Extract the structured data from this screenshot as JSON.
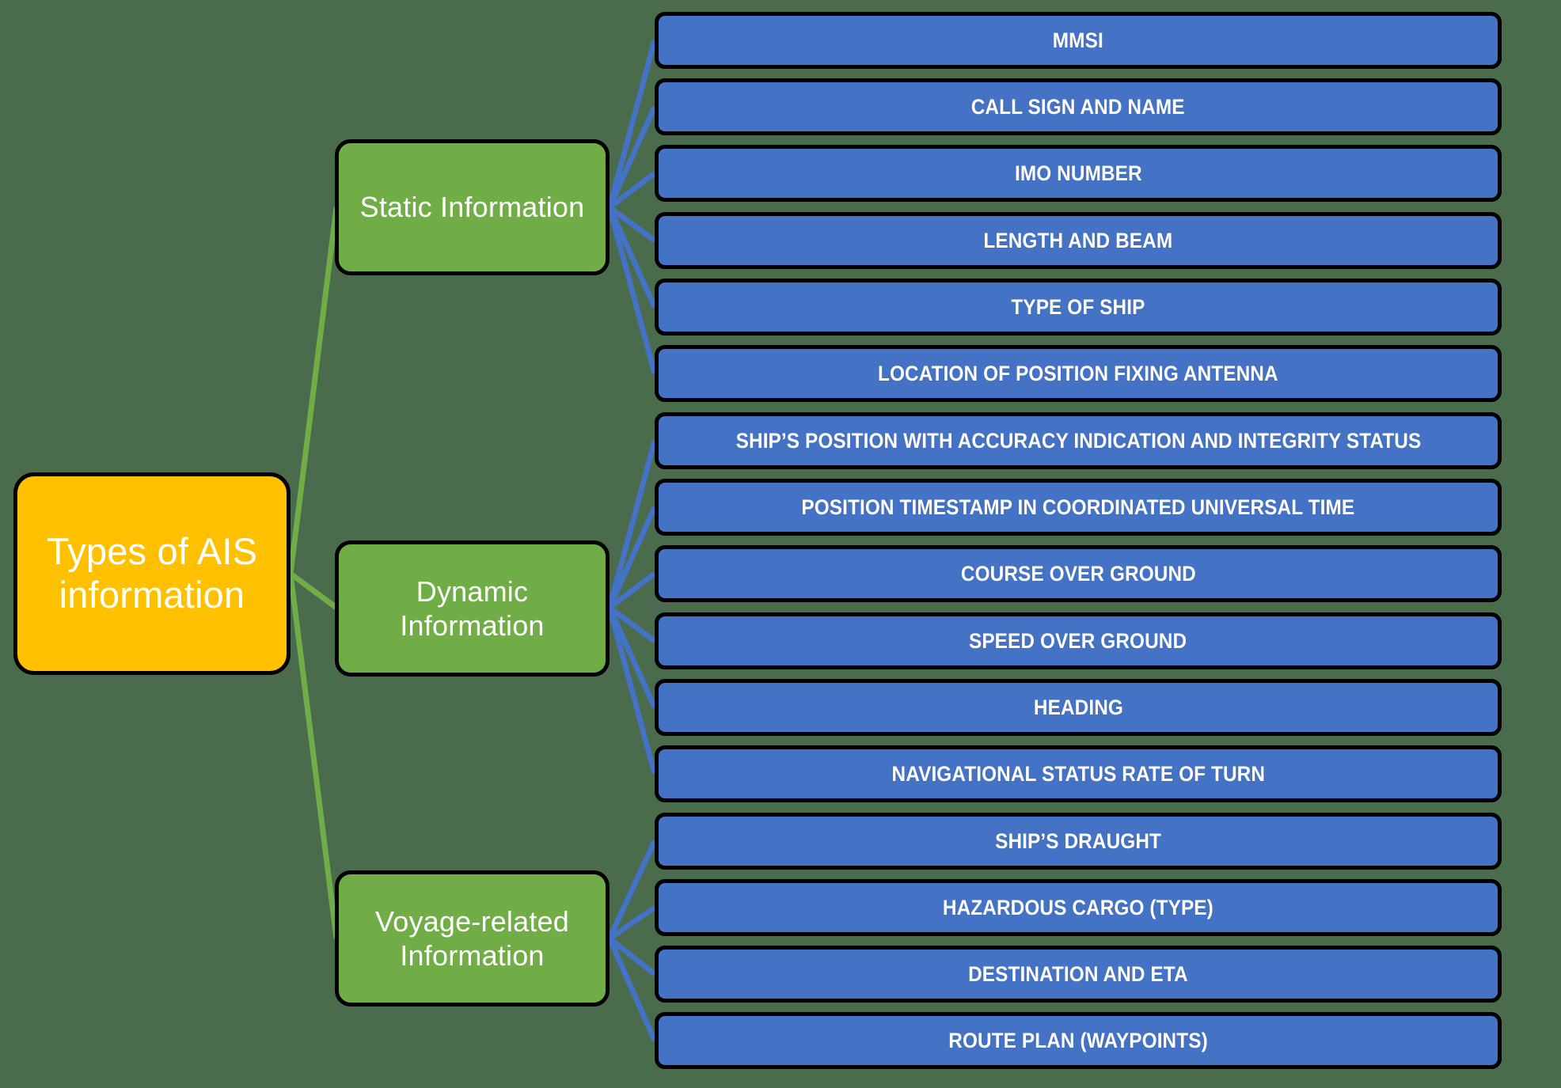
{
  "diagram": {
    "title": "Types of AIS information",
    "colors": {
      "background": "#4a6b4c",
      "root_fill": "#ffc000",
      "category_fill": "#70ad47",
      "leaf_fill": "#4472c4",
      "outline": "#000000",
      "root_edge_line": "#70ad47",
      "leaf_edge_line": "#4472c4",
      "text": "#ffffff"
    },
    "root": {
      "label": "Types of AIS information",
      "line1": "Types of AIS",
      "line2": "information"
    },
    "categories": [
      {
        "id": "static",
        "label": "Static Information",
        "items": [
          "MMSI",
          "CALL SIGN AND NAME",
          "IMO NUMBER",
          "LENGTH AND BEAM",
          "TYPE OF SHIP",
          "LOCATION OF POSITION FIXING ANTENNA"
        ]
      },
      {
        "id": "dynamic",
        "label": "Dynamic Information",
        "items": [
          "SHIP’S POSITION WITH ACCURACY INDICATION AND INTEGRITY STATUS",
          "POSITION TIMESTAMP IN COORDINATED UNIVERSAL TIME",
          "COURSE OVER GROUND",
          "SPEED OVER GROUND",
          "HEADING",
          "NAVIGATIONAL STATUS RATE OF TURN"
        ]
      },
      {
        "id": "voyage",
        "label": "Voyage-related Information",
        "items": [
          "SHIP’S DRAUGHT",
          "HAZARDOUS CARGO (TYPE)",
          "DESTINATION AND ETA",
          "ROUTE PLAN (WAYPOINTS)"
        ]
      }
    ],
    "leaves": [
      "MMSI",
      "CALL SIGN AND NAME",
      "IMO NUMBER",
      "LENGTH AND BEAM",
      "TYPE OF SHIP",
      "LOCATION OF POSITION FIXING ANTENNA",
      "SHIP’S POSITION WITH ACCURACY INDICATION AND INTEGRITY STATUS",
      "POSITION TIMESTAMP IN COORDINATED UNIVERSAL TIME",
      "COURSE OVER GROUND",
      "SPEED OVER GROUND",
      "HEADING",
      "NAVIGATIONAL STATUS RATE OF TURN",
      "SHIP’S DRAUGHT",
      "HAZARDOUS CARGO (TYPE)",
      "DESTINATION AND ETA",
      "ROUTE PLAN (WAYPOINTS)"
    ]
  }
}
